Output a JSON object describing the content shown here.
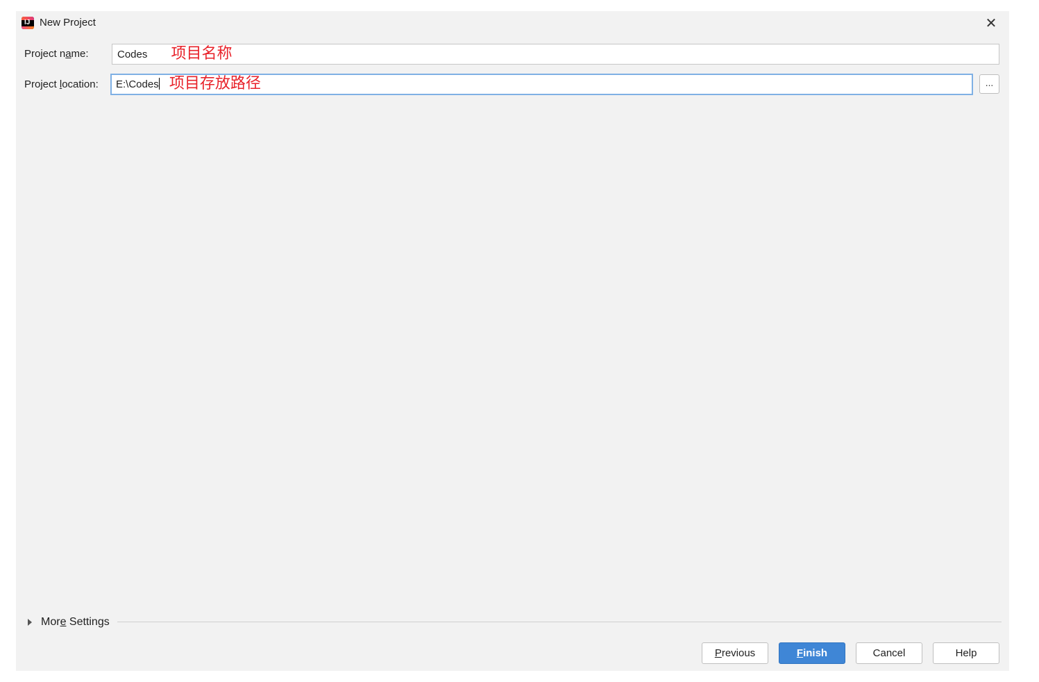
{
  "window": {
    "title": "New Project",
    "close_glyph": "✕",
    "app_icon": "intellij-idea-icon",
    "app_icon_glyph": "IJ"
  },
  "form": {
    "name_label_pre": "Project n",
    "name_label_ul": "a",
    "name_label_post": "me:",
    "name_value": "Codes",
    "name_annotation": "项目名称",
    "location_label_pre": "Project ",
    "location_label_ul": "l",
    "location_label_post": "ocation:",
    "location_value": "E:\\Codes",
    "location_annotation": "项目存放路径",
    "browse_label": "..."
  },
  "more_settings": {
    "pre": "Mor",
    "ul": "e",
    "post": " Settings"
  },
  "buttons": {
    "previous_ul": "P",
    "previous_rest": "revious",
    "finish_ul": "F",
    "finish_rest": "inish",
    "cancel": "Cancel",
    "help": "Help"
  },
  "colors": {
    "annotation": "#e8222a",
    "primary_button": "#3f86d6",
    "focus_border": "#7fb0e4"
  }
}
